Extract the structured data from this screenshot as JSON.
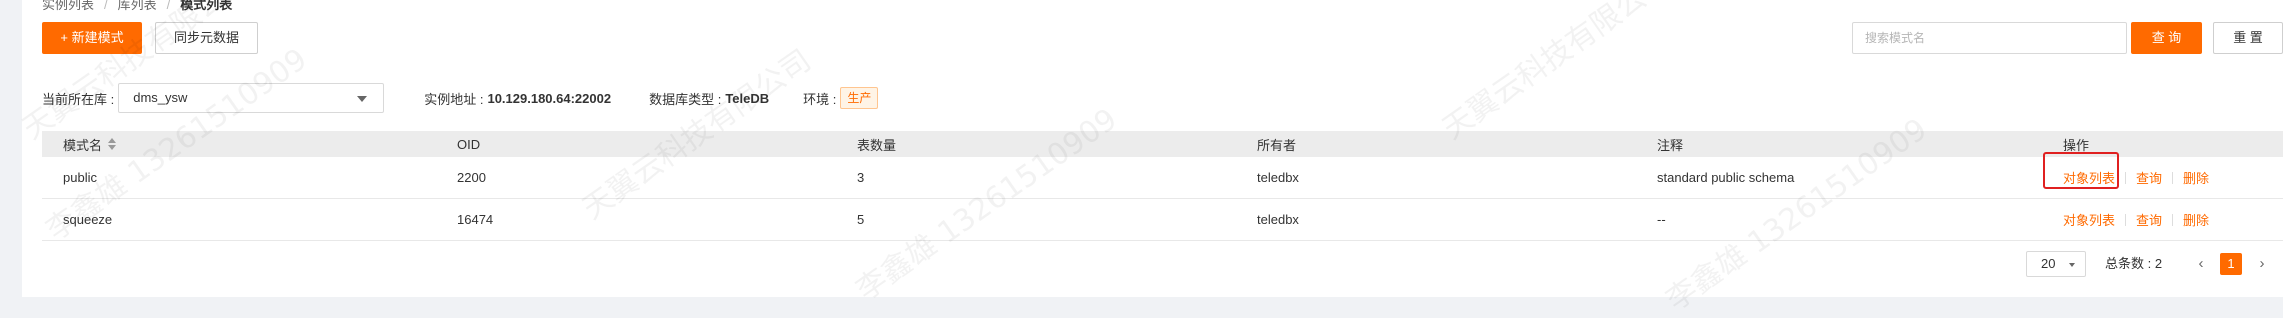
{
  "breadcrumb": [
    "实例列表",
    "库列表",
    "模式列表"
  ],
  "toolbar": {
    "new_schema_label": "+ 新建模式",
    "sync_metadata_label": "同步元数据",
    "search_placeholder": "搜索模式名",
    "query_label": "查 询",
    "reset_label": "重 置"
  },
  "info": {
    "db_label": "当前所在库 :",
    "db_selected": "dms_ysw",
    "instance_label": "实例地址 :",
    "instance_value": "10.129.180.64:22002",
    "db_type_label": "数据库类型 :",
    "db_type_value": "TeleDB",
    "env_label": "环境 :",
    "env_value": "生产"
  },
  "table": {
    "columns": [
      "模式名",
      "OID",
      "表数量",
      "所有者",
      "注释",
      "操作"
    ],
    "rows": [
      {
        "name": "public",
        "oid": "2200",
        "tables": "3",
        "owner": "teledbx",
        "comment": "standard public schema"
      },
      {
        "name": "squeeze",
        "oid": "16474",
        "tables": "5",
        "owner": "teledbx",
        "comment": "--"
      }
    ],
    "actions": {
      "objects": "对象列表",
      "query": "查询",
      "delete": "删除"
    }
  },
  "pagination": {
    "page_size": "20",
    "total_text": "总条数 : 2",
    "current_page": "1",
    "prev_icon": "chevron-left-icon",
    "next_icon": "chevron-right-icon"
  },
  "watermark": {
    "company": "天翼云科技有限公司",
    "user": "李鑫雄 13261510909"
  },
  "colors": {
    "accent": "#ff6a00",
    "highlight": "#e02020"
  }
}
